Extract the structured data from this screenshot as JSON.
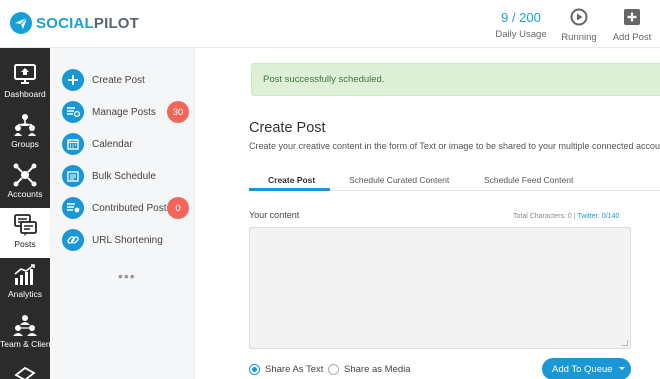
{
  "app": {
    "logo_text_1": "SOCIAL",
    "logo_text_2": "PILOT",
    "brand_color": "#1a98d5"
  },
  "header": {
    "usage_value": "9 / 200",
    "usage_label": "Daily Usage",
    "running_label": "Running",
    "add_post_label": "Add Post"
  },
  "rail": {
    "items": [
      {
        "label": "Dashboard",
        "icon": "monitor-icon"
      },
      {
        "label": "Groups",
        "icon": "groups-icon"
      },
      {
        "label": "Accounts",
        "icon": "accounts-icon"
      },
      {
        "label": "Posts",
        "icon": "posts-icon",
        "active": true
      },
      {
        "label": "Analytics",
        "icon": "analytics-icon"
      },
      {
        "label": "Team & Client",
        "icon": "team-icon"
      }
    ]
  },
  "menu": {
    "items": [
      {
        "label": "Create Post",
        "icon": "plus-icon"
      },
      {
        "label": "Manage Posts",
        "icon": "manage-icon",
        "badge": "30"
      },
      {
        "label": "Calendar",
        "icon": "calendar-icon"
      },
      {
        "label": "Bulk Schedule",
        "icon": "bulk-icon"
      },
      {
        "label": "Contributed Posts",
        "icon": "contributed-icon",
        "badge": "0"
      },
      {
        "label": "URL Shortening",
        "icon": "link-icon"
      }
    ],
    "more": "•••"
  },
  "main": {
    "alert": "Post successfully scheduled.",
    "title": "Create Post",
    "subtitle": "Create your creative content in the form of Text or image to be shared to your multiple connected accou",
    "tabs": [
      {
        "label": "Create Post",
        "active": true
      },
      {
        "label": "Schedule Curated Content"
      },
      {
        "label": "Schedule Feed Content"
      }
    ],
    "content_label": "Your content",
    "char_count": "Total Characters: 0 |",
    "twitter_count": "Twitter: 0/140",
    "share_text_label": "Share As Text",
    "share_media_label": "Share as Media",
    "share_mode": "text",
    "queue_button": "Add To Queue"
  }
}
